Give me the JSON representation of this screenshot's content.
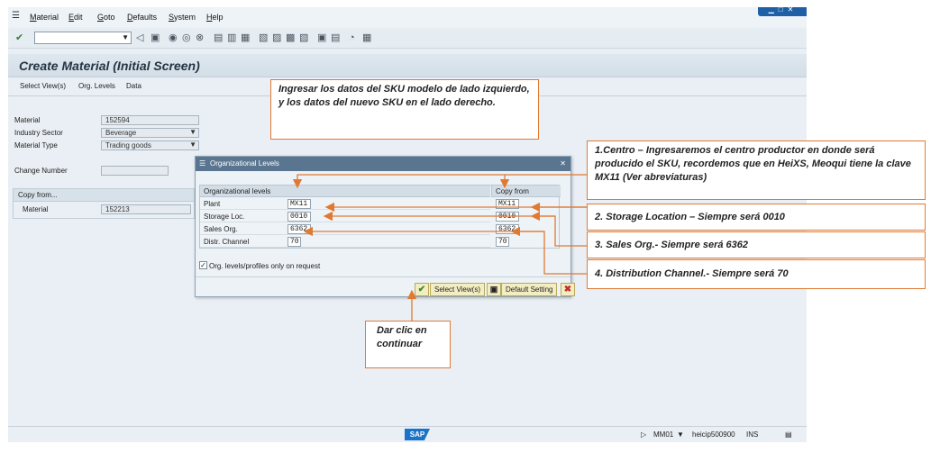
{
  "menu": {
    "items": [
      {
        "label": "Material",
        "underline": "M",
        "rest": "aterial"
      },
      {
        "label": "Edit",
        "underline": "E",
        "rest": "dit"
      },
      {
        "label": "Goto",
        "underline": "G",
        "rest": "oto"
      },
      {
        "label": "Defaults",
        "underline": "D",
        "rest": "efaults"
      },
      {
        "label": "System",
        "underline": "S",
        "rest": "ystem"
      },
      {
        "label": "Help",
        "underline": "H",
        "rest": "elp"
      }
    ]
  },
  "screen": {
    "title": "Create Material (Initial Screen)",
    "app_toolbar": [
      "Select View(s)",
      "Org. Levels",
      "Data"
    ],
    "fields": {
      "material_label": "Material",
      "material_value": "152594",
      "industry_label": "Industry Sector",
      "industry_value": "Beverage",
      "type_label": "Material Type",
      "type_value": "Trading goods",
      "change_label": "Change Number",
      "change_value": ""
    },
    "copy_from": {
      "header": "Copy from...",
      "material_label": "Material",
      "material_value": "152213"
    }
  },
  "dialog": {
    "title": "Organizational Levels",
    "col_left": "Organizational levels",
    "col_right": "Copy from",
    "rows": [
      {
        "label": "Plant",
        "value": "MX11",
        "copy": "MX11"
      },
      {
        "label": "Storage Loc.",
        "value": "0010",
        "copy": "0010"
      },
      {
        "label": "Sales Org.",
        "value": "6362",
        "copy": "6362"
      },
      {
        "label": "Distr. Channel",
        "value": "70",
        "copy": "70"
      }
    ],
    "checkbox_label": "Org. levels/profiles only on request",
    "select_views_label": "Select View(s)",
    "default_setting_label": "Default Setting"
  },
  "statusbar": {
    "brand": "SAP",
    "session": "MM01",
    "server": "heicip500900",
    "mode": "INS"
  },
  "annotations": {
    "main_note": "Ingresar los datos del SKU modelo de lado izquierdo, y los datos del nuevo SKU en el lado derecho.",
    "note_1": "1.Centro – Ingresaremos el centro productor en donde será producido el SKU, recordemos que en HeiXS, Meoqui tiene la clave MX11 (Ver abreviaturas)",
    "note_2": "2. Storage Location – Siempre será 0010",
    "note_3": "3. Sales Org.- Siempre será 6362",
    "note_4": "4. Distribution Channel.- Siempre será 70",
    "note_click": "Dar clic en continuar"
  },
  "colors": {
    "annotation_border": "#e07a33",
    "dialog_title_bg": "#5a7590",
    "button_bg": "#f3edc2",
    "sap_blue": "#1a73c9"
  }
}
